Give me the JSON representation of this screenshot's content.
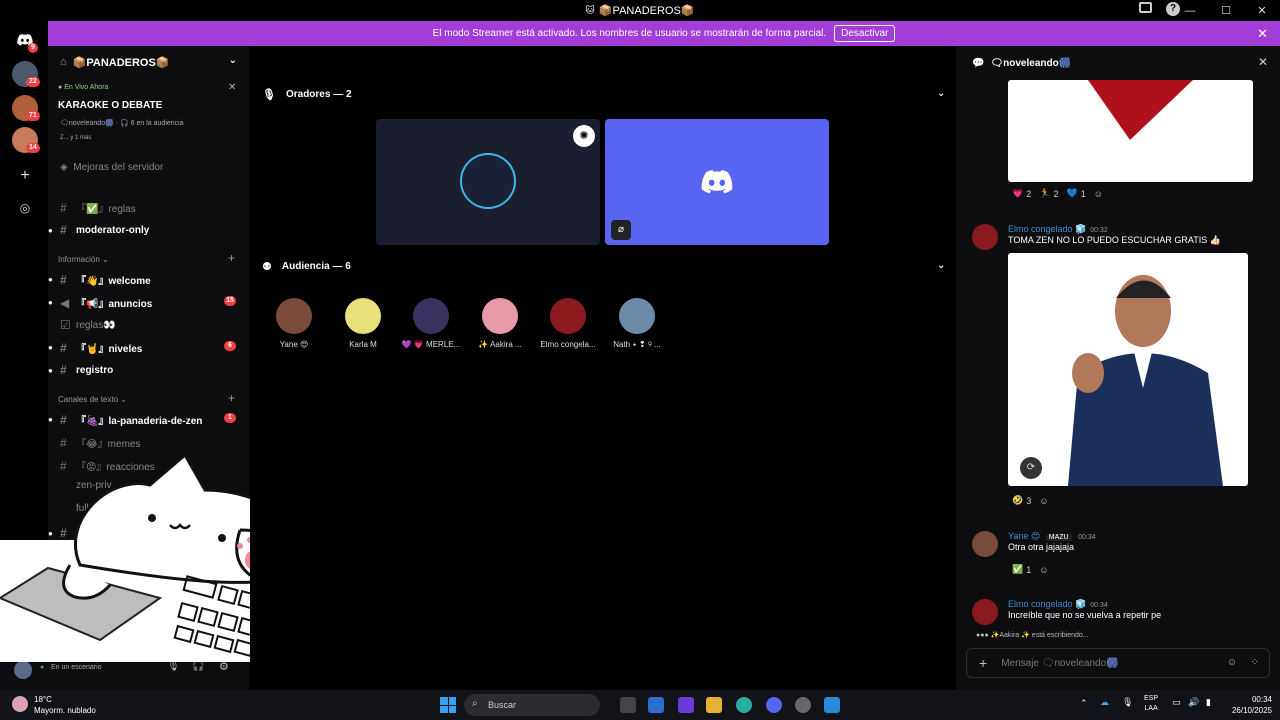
{
  "window": {
    "title": "📦PANADEROS📦"
  },
  "banner": {
    "text": "El modo Streamer está activado. Los nombres de usuario se mostrarán de forma parcial.",
    "button": "Desactivar"
  },
  "rail": {
    "badges": [
      "9",
      "22",
      "71",
      "14"
    ]
  },
  "server": {
    "name": "📦PANADEROS📦"
  },
  "event": {
    "live": "En Vivo Ahora",
    "title": "KARAOKE O DEBATE",
    "host": "🗨noveleando🎆 · 🎧 6 en la audiencia",
    "others": "Z... y 1 más"
  },
  "boost": "Mejoras del servidor",
  "channels": {
    "reglas_top": "『✅』reglas",
    "moderator": "moderator-only",
    "cat_info": "Información ⌄",
    "welcome": "『👋』welcome",
    "anuncios": "『📢』anuncios",
    "anuncios_badge": "15",
    "reglas": "reglas👀",
    "niveles": "『🤘』niveles",
    "niveles_badge": "6",
    "registro": "registro",
    "cat_text": "Canales de texto ⌄",
    "panaderia": "『🍇』la-panaderia-de-zen",
    "panaderia_badge": "1",
    "memes": "『😂』memes",
    "reacciones": "『😡』reacciones",
    "zenpriv": "zen-priv",
    "full": "full-t",
    "s": "s"
  },
  "user": {
    "status": "En un escenario"
  },
  "stage": {
    "speakers_header": "Oradores — 2",
    "audience_header": "Audiencia — 6",
    "audience": [
      {
        "name": "Yane 😍",
        "color": "#7a4a3a"
      },
      {
        "name": "Karla M",
        "color": "#e8e07a"
      },
      {
        "name": "💜 💗 MERLE...",
        "color": "#3a3160"
      },
      {
        "name": "✨ Aakira ...",
        "color": "#e89aa8"
      },
      {
        "name": "Elmo congela...",
        "color": "#8a1a1e"
      },
      {
        "name": "Nath ٭ ❢ ୨ ...",
        "color": "#6a8aa8"
      }
    ]
  },
  "chat": {
    "channel": "🗨noveleando🎆",
    "heart_reacts": [
      {
        "e": "💗",
        "n": "2"
      },
      {
        "e": "🏃",
        "n": "2"
      },
      {
        "e": "💙",
        "n": "1"
      }
    ],
    "msg1": {
      "who": "Elmo congelado 🧊",
      "time": "00:32",
      "text": "TOMA ZEN NO LO PUEDO ESCUCHAR GRATIS 👍🏻"
    },
    "react2": {
      "e": "🤣",
      "n": "3"
    },
    "msg2": {
      "who": "Yane 😍",
      "tag": "MAZU",
      "time": "00:34",
      "text": "Otra otra jajajaja"
    },
    "react3": {
      "e": "✅",
      "n": "1"
    },
    "msg3": {
      "who": "Elmo congelado 🧊",
      "time": "00:34",
      "text": "Increíble que no se vuelva a repetir pe"
    },
    "typing": "✨Aakira ✨ está escribiendo...",
    "placeholder": "Mensaje 🗨noveleando🎆"
  },
  "taskbar": {
    "temp": "18°C",
    "weather": "Mayorm. nublado",
    "search": "Buscar",
    "lang1": "ESP",
    "lang2": "LAA",
    "time": "00:34",
    "date": "26/10/2025"
  },
  "colors": {
    "blurple": "#5865f2",
    "banner": "#a33dd8",
    "danger": "#f23f43"
  }
}
